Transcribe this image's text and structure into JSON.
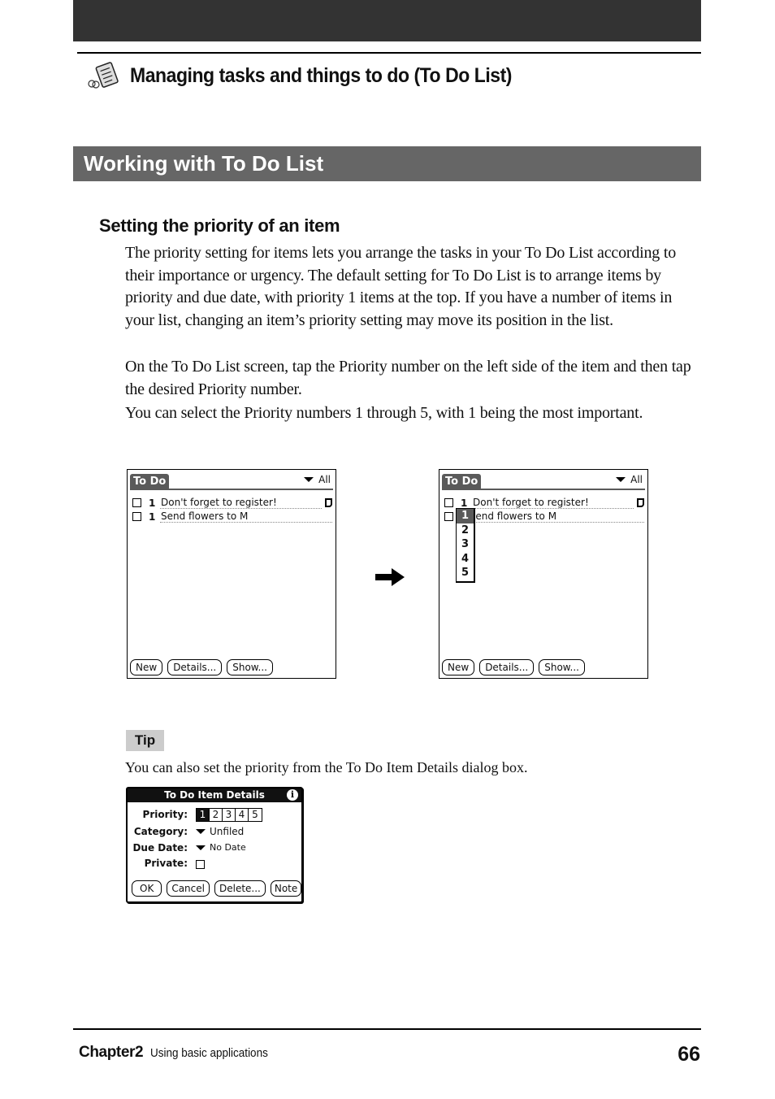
{
  "header": {
    "chapter_title": "Managing tasks and things to do (To Do List)",
    "chapter_icon": "todo-list-icon"
  },
  "section": {
    "title": "Working with To Do List",
    "subheading": "Setting the priority of an item",
    "paragraphs": [
      "The priority setting for items lets you arrange the tasks in your To Do List according to their importance or urgency. The default setting for To Do List is to arrange items by priority and due date, with priority 1 items at the top. If you have a number of items in your list, changing an item’s priority setting may move its position in the list.",
      "On the To Do List screen, tap the Priority number on the left side of the item and then tap the desired Priority number.",
      "You can select the Priority numbers 1 through 5, with 1 being the most important."
    ]
  },
  "screens": {
    "app_title": "To Do",
    "category": "All",
    "items": [
      {
        "priority": "1",
        "text": "Don't forget to register!",
        "has_note": true
      },
      {
        "priority": "1",
        "text": "Send flowers to M",
        "has_note": false
      }
    ],
    "right_item2_text": "iend flowers to M",
    "buttons": [
      "New",
      "Details...",
      "Show..."
    ],
    "priority_popup": {
      "options": [
        "1",
        "2",
        "3",
        "4",
        "5"
      ],
      "selected": "1"
    }
  },
  "tip": {
    "label": "Tip",
    "text": "You can also set the priority from the To Do Item Details dialog box."
  },
  "dialog": {
    "title": "To Do Item Details",
    "info_glyph": "i",
    "priority_label": "Priority:",
    "priority_options": [
      "1",
      "2",
      "3",
      "4",
      "5"
    ],
    "priority_selected": "1",
    "category_label": "Category:",
    "category_value": "Unfiled",
    "due_date_label": "Due Date:",
    "due_date_value": "No Date",
    "private_label": "Private:",
    "private_checked": false,
    "buttons": [
      "OK",
      "Cancel",
      "Delete...",
      "Note"
    ]
  },
  "footer": {
    "chapter": "Chapter2",
    "chapter_subtitle": "Using basic applications",
    "page_number": "66"
  },
  "colors": {
    "top_bar": "#333333",
    "section_bar": "#666666",
    "tip_bg": "#cccccc",
    "palm_tab": "#5a5a5a"
  }
}
